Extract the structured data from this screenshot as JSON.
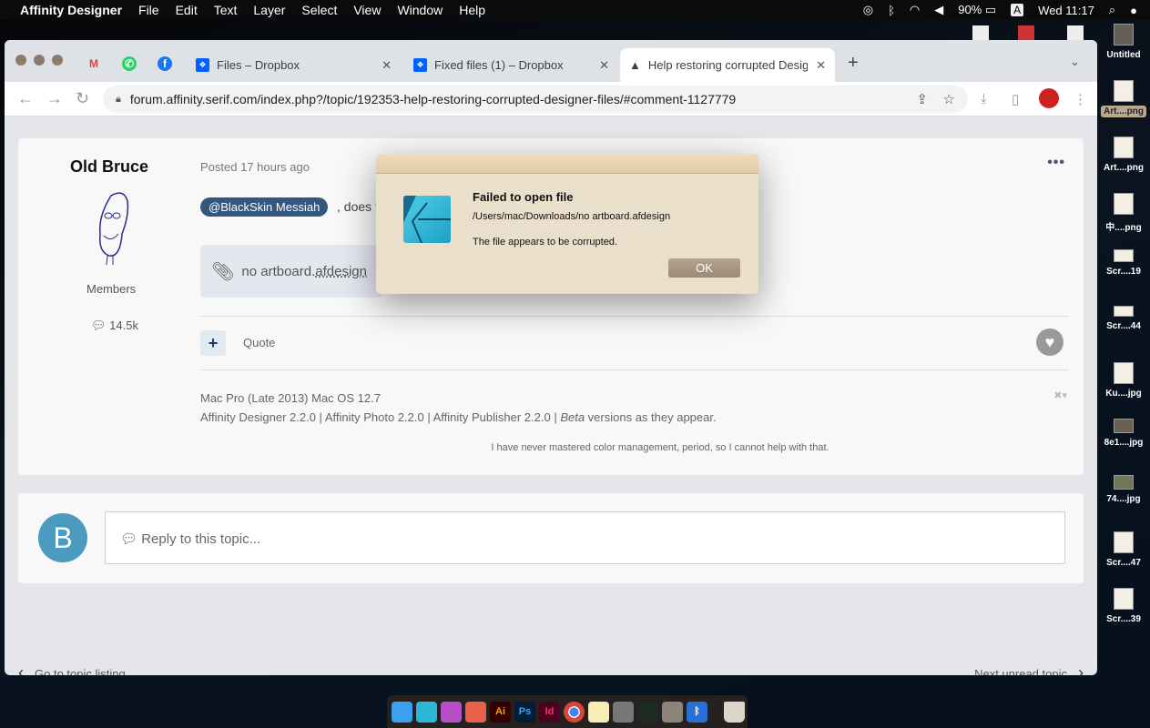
{
  "menubar": {
    "app": "Affinity Designer",
    "items": [
      "File",
      "Edit",
      "Text",
      "Layer",
      "Select",
      "View",
      "Window",
      "Help"
    ],
    "battery": "90%",
    "input": "A",
    "clock": "Wed 11:17"
  },
  "desktop": {
    "icons": [
      {
        "label": "Untitled"
      },
      {
        "label": "Art....png",
        "selected": true
      },
      {
        "label": "Art....png"
      },
      {
        "label": "中....png"
      },
      {
        "label": "Scr....19"
      },
      {
        "label": "Scr....44"
      },
      {
        "label": "Ku....jpg"
      },
      {
        "label": "8e1....jpg"
      },
      {
        "label": "74....jpg"
      },
      {
        "label": "Scr....47"
      },
      {
        "label": "Scr....39"
      }
    ]
  },
  "browser": {
    "pinned": [
      "M",
      "✆",
      "f"
    ],
    "tabs": [
      {
        "title": "Files – Dropbox"
      },
      {
        "title": "Fixed files (1) – Dropbox"
      },
      {
        "title": "Help restoring corrupted Desig",
        "active": true
      }
    ],
    "url": "forum.affinity.serif.com/index.php?/topic/192353-help-restoring-corrupted-designer-files/#comment-1127779"
  },
  "post": {
    "author": "Old Bruce",
    "role": "Members",
    "post_count": "14.5k",
    "posted": "Posted 17 hours ago",
    "mention": "@BlackSkin Messiah",
    "body": ", does t",
    "attachment_name": "no artboard.",
    "attachment_ext": "afdesign",
    "quote": "Quote",
    "sig_line1": "Mac Pro (Late 2013) Mac OS 12.7",
    "sig_line2": "Affinity Designer 2.2.0 | Affinity Photo 2.2.0 | Affinity Publisher 2.2.0 | ",
    "sig_line2_italic": "Beta",
    "sig_line2_end": " versions as they appear.",
    "sig_line3": "I have never mastered color management, period, so I cannot help with that."
  },
  "reply": {
    "avatar_letter": "B",
    "placeholder": "Reply to this topic..."
  },
  "footer_nav": {
    "prev": "Go to topic listing",
    "next": "Next unread topic"
  },
  "dialog": {
    "title": "Failed to open file",
    "path": "/Users/mac/Downloads/no artboard.afdesign",
    "message": "The file appears to be corrupted.",
    "ok": "OK"
  },
  "dock": {
    "apps": [
      "Finder",
      "Affinity Designer",
      "Affinity Photo",
      "Affinity Publisher",
      "Ai",
      "Ps",
      "Id",
      "Chrome",
      "Notes",
      "System Preferences",
      "Activity Monitor",
      "Disk Utility",
      "Bluetooth",
      "Trash"
    ]
  }
}
